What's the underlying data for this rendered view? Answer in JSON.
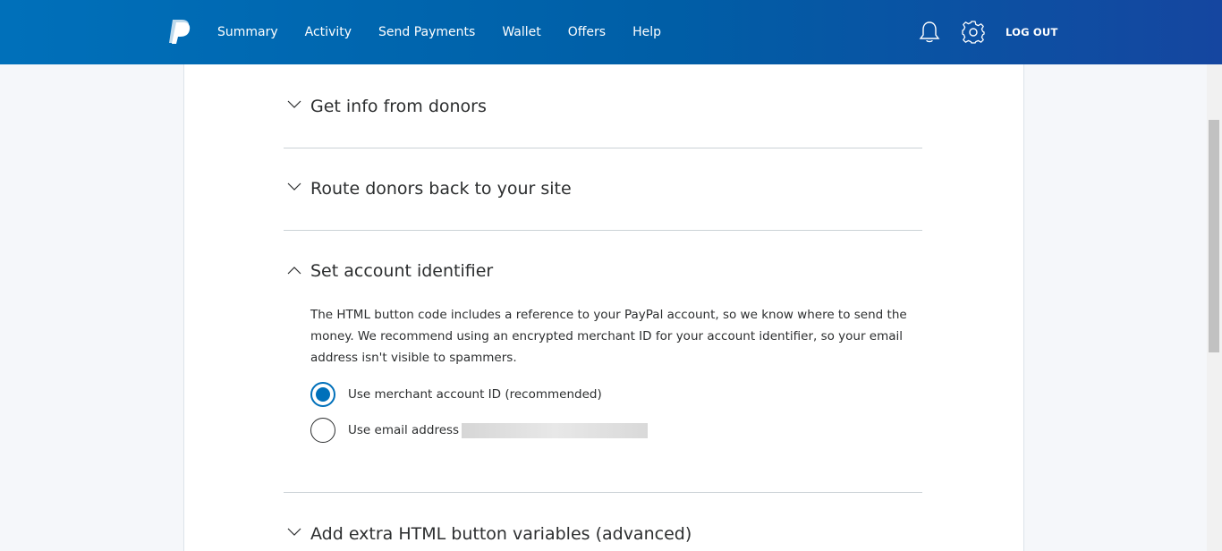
{
  "header": {
    "nav": [
      "Summary",
      "Activity",
      "Send Payments",
      "Wallet",
      "Offers",
      "Help"
    ],
    "logout_label": "LOG OUT",
    "brand_color": "#0070ba"
  },
  "sections": {
    "get_info": {
      "title": "Get info from donors",
      "expanded": false
    },
    "route_donors": {
      "title": "Route donors back to your site",
      "expanded": false
    },
    "account_identifier": {
      "title": "Set account identifier",
      "expanded": true,
      "description": "The HTML button code includes a reference to your PayPal account, so we know where to send the money. We recommend using an encrypted merchant ID for your account identifier, so your email address isn't visible to spammers.",
      "options": [
        {
          "label": "Use merchant account ID (recommended)",
          "selected": true
        },
        {
          "label": "Use email address",
          "selected": false
        }
      ]
    },
    "extra_variables": {
      "title": "Add extra HTML button variables (advanced)",
      "expanded": false
    }
  }
}
